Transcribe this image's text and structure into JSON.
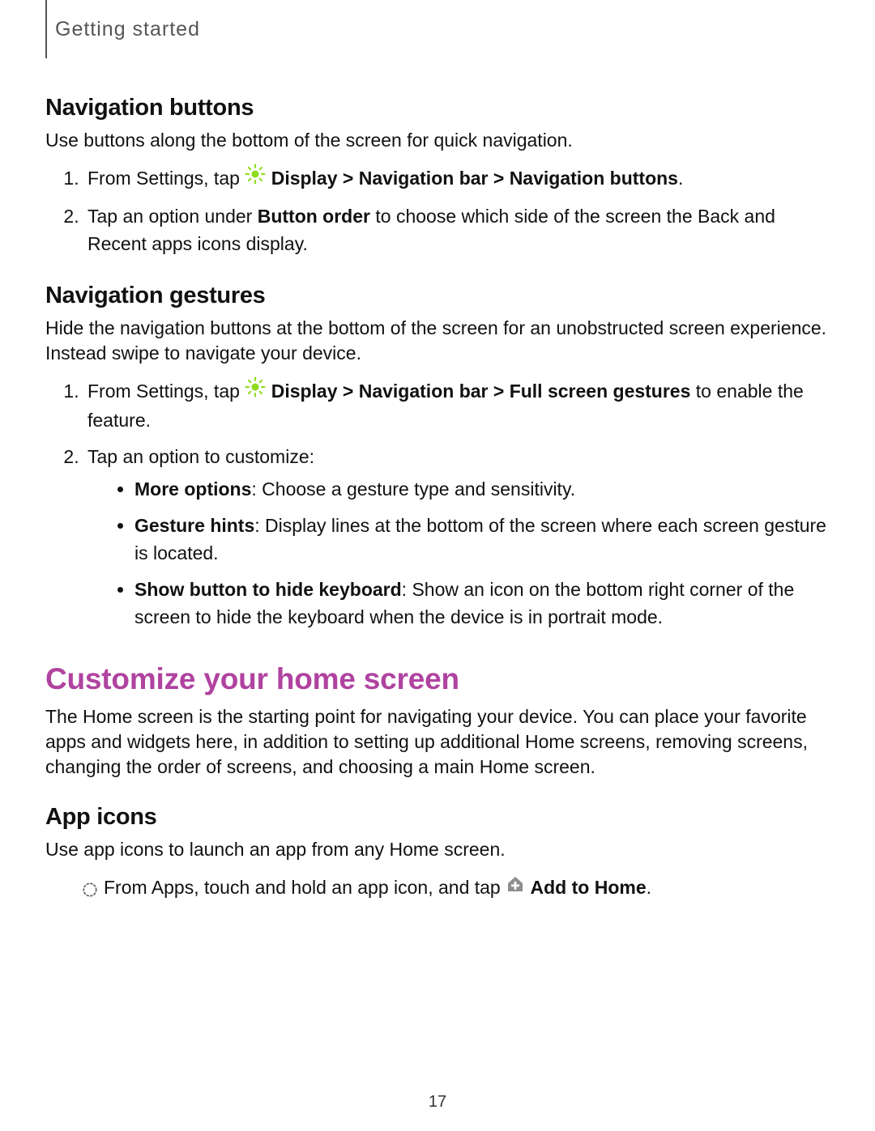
{
  "breadcrumb": "Getting started",
  "nav_buttons": {
    "heading": "Navigation buttons",
    "intro": "Use buttons along the bottom of the screen for quick navigation.",
    "step1_pre": "From Settings, tap ",
    "step1_bold": "Display > Navigation bar > Navigation buttons",
    "step1_post": ".",
    "step2_pre": "Tap an option under ",
    "step2_bold": "Button order",
    "step2_post": " to choose which side of the screen the Back and Recent apps icons display."
  },
  "nav_gestures": {
    "heading": "Navigation gestures",
    "intro": "Hide the navigation buttons at the bottom of the screen for an unobstructed screen experience. Instead swipe to navigate your device.",
    "step1_pre": "From Settings, tap ",
    "step1_bold": "Display > Navigation bar > Full screen gestures",
    "step1_post": " to enable the feature.",
    "step2": "Tap an option to customize:",
    "b1_bold": "More options",
    "b1_post": ": Choose a gesture type and sensitivity.",
    "b2_bold": "Gesture hints",
    "b2_post": ": Display lines at the bottom of the screen where each screen gesture is located.",
    "b3_bold": "Show button to hide keyboard",
    "b3_post": ": Show an icon on the bottom right corner of the screen to hide the keyboard when the device is in portrait mode."
  },
  "customize": {
    "heading": "Customize your home screen",
    "intro": "The Home screen is the starting point for navigating your device. You can place your favorite apps and widgets here, in addition to setting up additional Home screens, removing screens, changing the order of screens, and choosing a main Home screen."
  },
  "app_icons": {
    "heading": "App icons",
    "intro": "Use app icons to launch an app from any Home screen.",
    "step_pre": "From Apps, touch and hold an app icon, and tap ",
    "step_bold": "Add to Home",
    "step_post": "."
  },
  "page_number": "17",
  "icons": {
    "brightness": "brightness-icon",
    "add_home": "add-to-home-icon",
    "ring": "dotted-ring-bullet"
  }
}
